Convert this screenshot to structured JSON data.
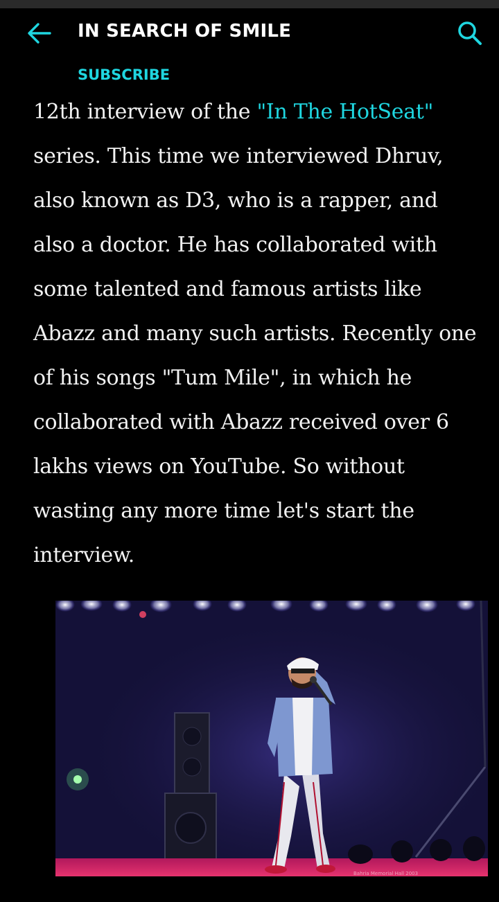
{
  "header": {
    "title": "IN SEARCH OF SMILE",
    "subscribe_label": "SUBSCRIBE",
    "back_icon": "arrow-left-icon",
    "search_icon": "search-icon"
  },
  "article": {
    "line_partial_pre": "12th interview of the ",
    "line_partial_link": "\"In The HotSeat\"",
    "body": "series. This time we interviewed Dhruv, also known as D3, who is a rapper, and also a doctor. He has collaborated with some talented and famous artists like Abazz and many such artists. Recently one of his songs \"Tum Mile\", in which he collaborated with Abazz received over 6 lakhs views on YouTube. So without wasting any more time let's start the interview."
  },
  "photo": {
    "watermark": "Bahria Memorial Hall 2003"
  },
  "colors": {
    "accent": "#1fd6e0",
    "background": "#000000",
    "text": "#f2f2f2"
  }
}
